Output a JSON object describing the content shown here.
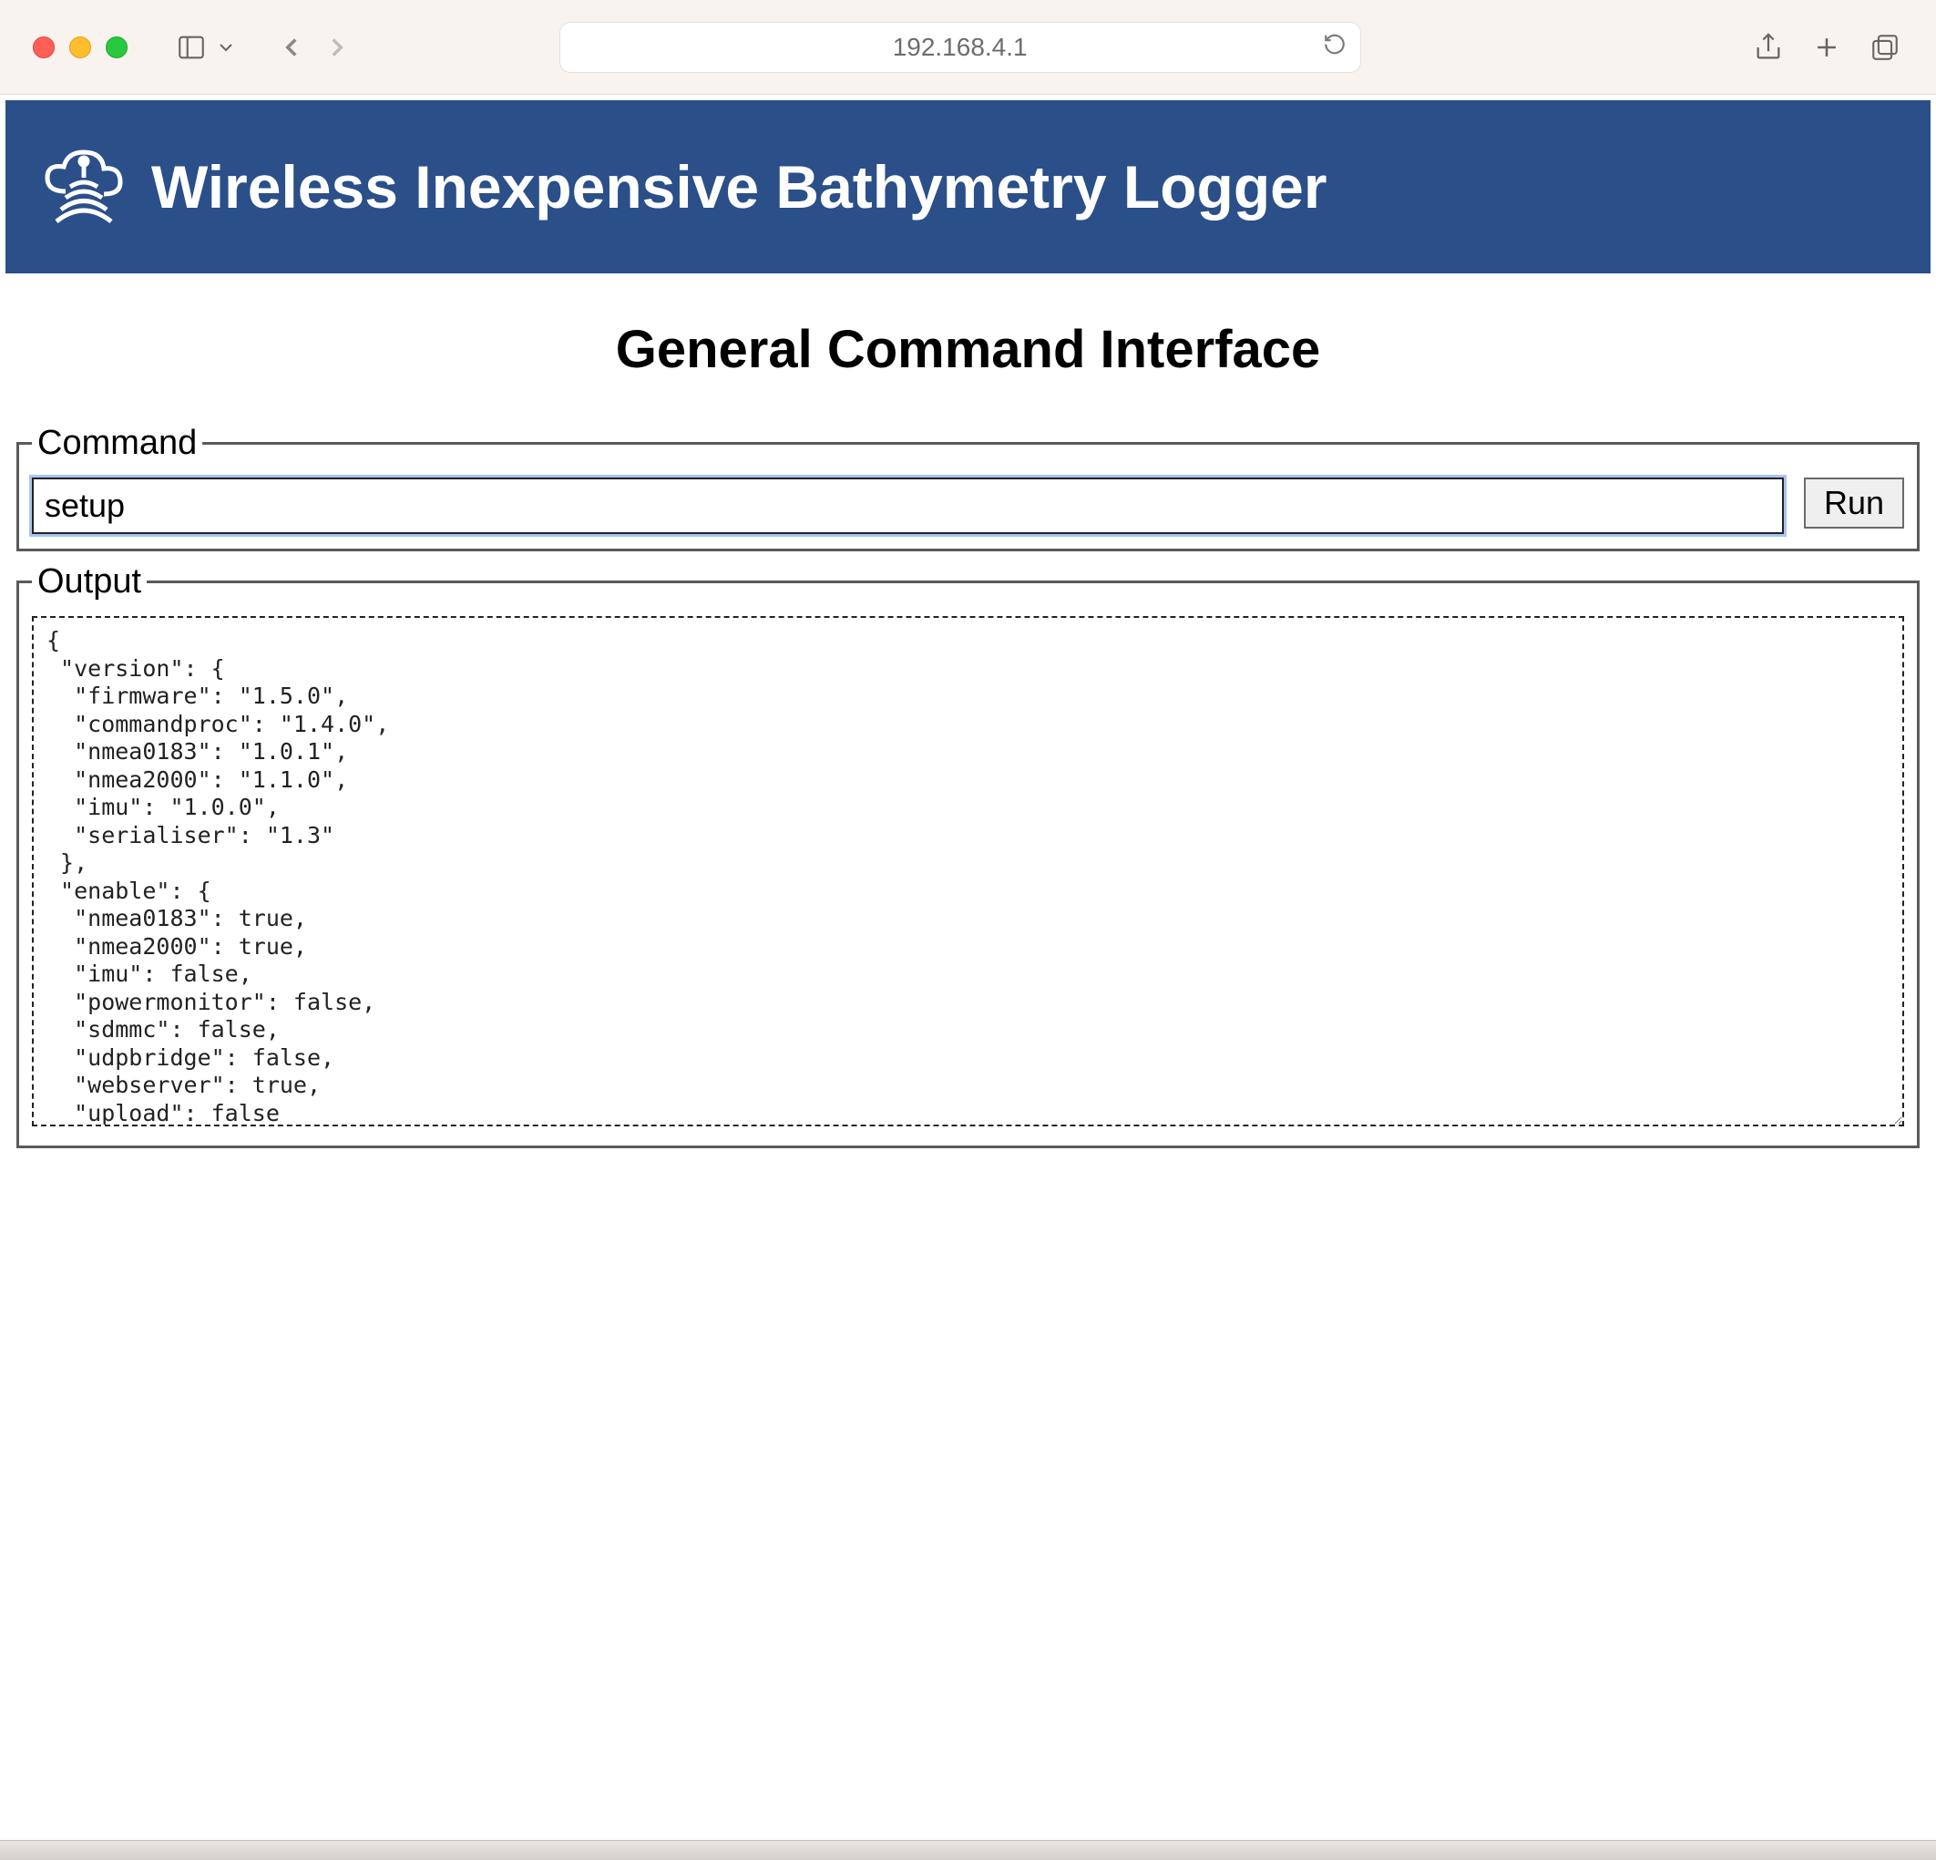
{
  "browser": {
    "url": "192.168.4.1"
  },
  "banner": {
    "title": "Wireless Inexpensive Bathymetry Logger"
  },
  "page": {
    "heading": "General Command Interface"
  },
  "command": {
    "legend": "Command",
    "value": "setup",
    "run_label": "Run"
  },
  "output": {
    "legend": "Output",
    "text": "{\n \"version\": {\n  \"firmware\": \"1.5.0\",\n  \"commandproc\": \"1.4.0\",\n  \"nmea0183\": \"1.0.1\",\n  \"nmea2000\": \"1.1.0\",\n  \"imu\": \"1.0.0\",\n  \"serialiser\": \"1.3\"\n },\n \"enable\": {\n  \"nmea0183\": true,\n  \"nmea2000\": true,\n  \"imu\": false,\n  \"powermonitor\": false,\n  \"sdmmc\": false,\n  \"udpbridge\": false,\n  \"webserver\": true,\n  \"upload\": false\n },\n \"wifi\": {"
  }
}
